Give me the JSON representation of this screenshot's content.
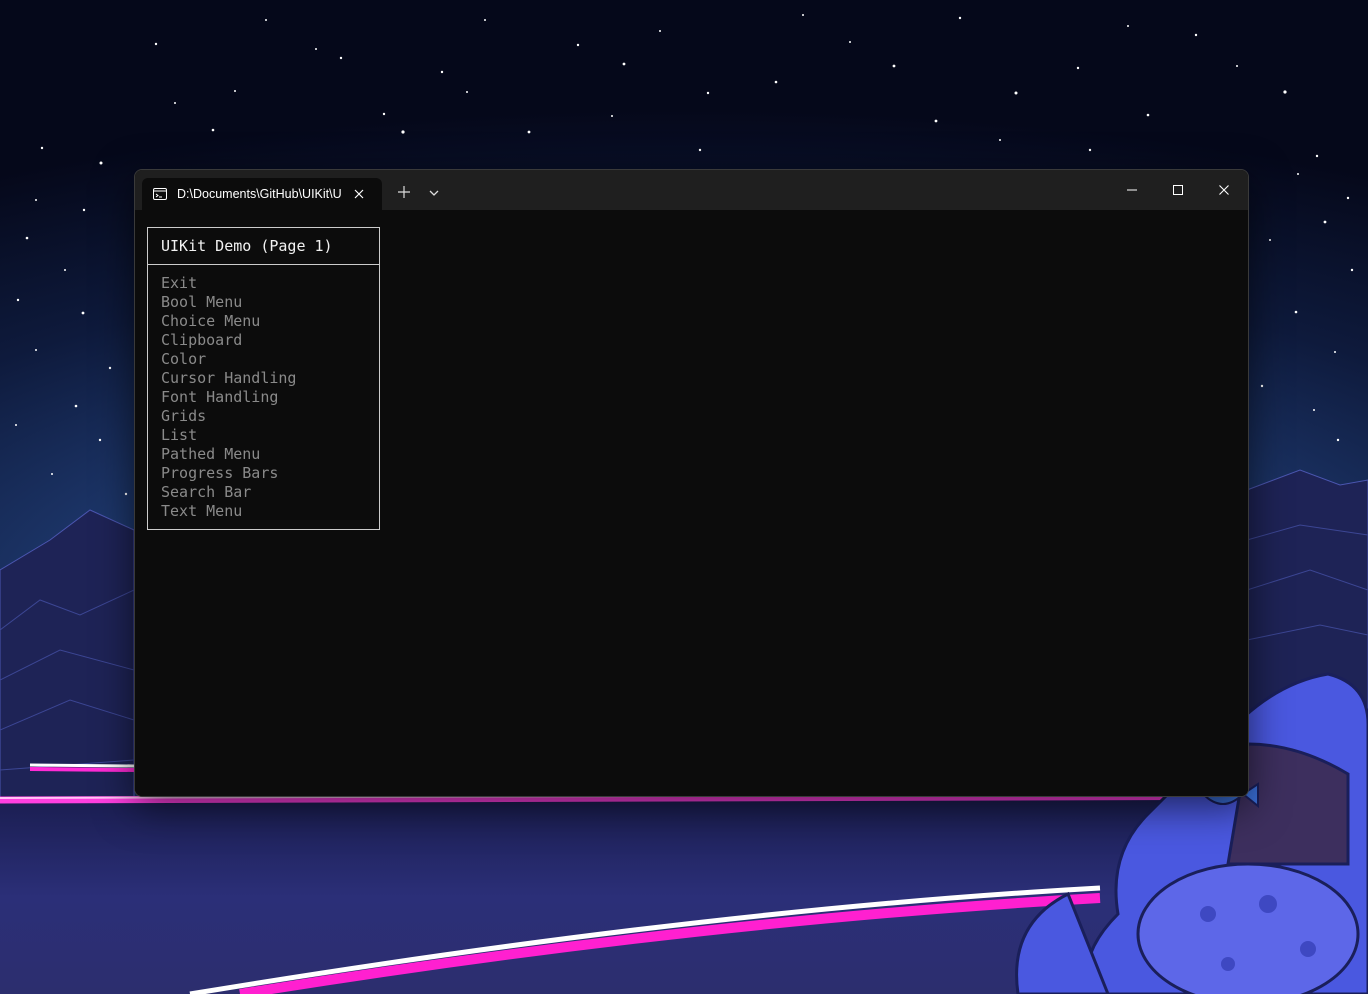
{
  "window": {
    "tab_title": "D:\\Documents\\GitHub\\UIKit\\UIKit",
    "icons": {
      "tab": "terminal-icon",
      "tab_close": "close-icon",
      "new_tab": "plus-icon",
      "dropdown": "chevron-down-icon",
      "minimize": "minimize-icon",
      "maximize": "maximize-icon",
      "close": "close-icon"
    }
  },
  "terminal": {
    "menu_title": "UIKit Demo (Page 1)",
    "items": [
      "Exit",
      "Bool Menu",
      "Choice Menu",
      "Clipboard",
      "Color",
      "Cursor Handling",
      "Font Handling",
      "Grids",
      "List",
      "Pathed Menu",
      "Progress Bars",
      "Search Bar",
      "Text Menu"
    ]
  },
  "colors": {
    "terminal_bg": "#0c0c0c",
    "titlebar_bg": "#1f1f1f",
    "menu_text": "#8a8a8a",
    "title_text": "#f2f2f2",
    "border": "#cccccc"
  }
}
